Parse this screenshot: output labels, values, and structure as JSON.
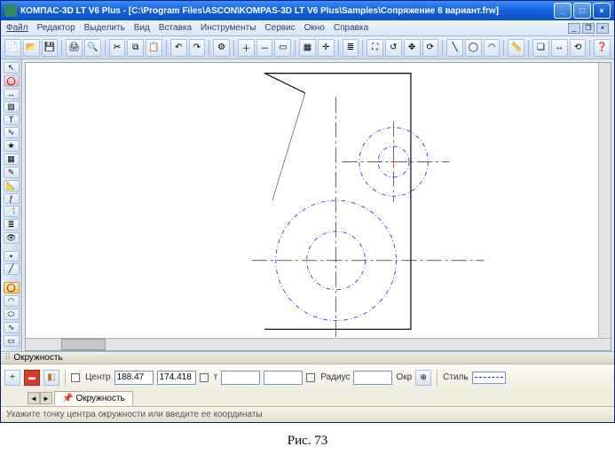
{
  "window": {
    "title": "КОМПАС-3D LT V6 Plus - [C:\\Program Files\\ASCON\\KOMPAS-3D LT V6 Plus\\Samples\\Сопряжение 6 вариант.frw]"
  },
  "menu": {
    "file": "Файл",
    "edit": "Редактор",
    "select": "Выделить",
    "view": "Вид",
    "insert": "Вставка",
    "tools": "Инструменты",
    "service": "Сервис",
    "window": "Окно",
    "help": "Справка"
  },
  "prop": {
    "panel_title": "Окружность",
    "center_label": "Центр",
    "cx": "188.47",
    "cy": "174.418",
    "f1": "",
    "f2": "",
    "radius_label": "Радиус",
    "radius": "",
    "diam_label": "Окр",
    "diam": "",
    "style_label": "Стиль",
    "tab": "Окружность"
  },
  "status": {
    "hint": "Укажите точку центра окружности или введите ее координаты"
  },
  "caption": "Рис. 73",
  "toolbar_icons": [
    "new",
    "open",
    "save",
    "sep",
    "print",
    "preview",
    "sep",
    "cut",
    "copy",
    "paste",
    "sep",
    "undo",
    "redo",
    "sep",
    "props",
    "sep",
    "zoom-in",
    "zoom-out",
    "zoom-rect",
    "sep",
    "grid",
    "snap",
    "sep",
    "layer",
    "sep",
    "fit",
    "prev-view",
    "pan",
    "refresh",
    "sep",
    "line",
    "circle",
    "arc",
    "sep",
    "ruler",
    "sep",
    "copy-obj",
    "move",
    "rotate",
    "sep",
    "help-ctx"
  ],
  "left_tools": [
    "select",
    "geom",
    "dim",
    "hatch",
    "text",
    "rough",
    "symbol",
    "table",
    "edit",
    "measure",
    "param",
    "spec",
    "layer",
    "view",
    "sep",
    "point",
    "segment",
    "sep",
    "circle",
    "arc-t",
    "ellipse",
    "spline",
    "rect",
    "sep",
    "chamfer",
    "fillet"
  ]
}
